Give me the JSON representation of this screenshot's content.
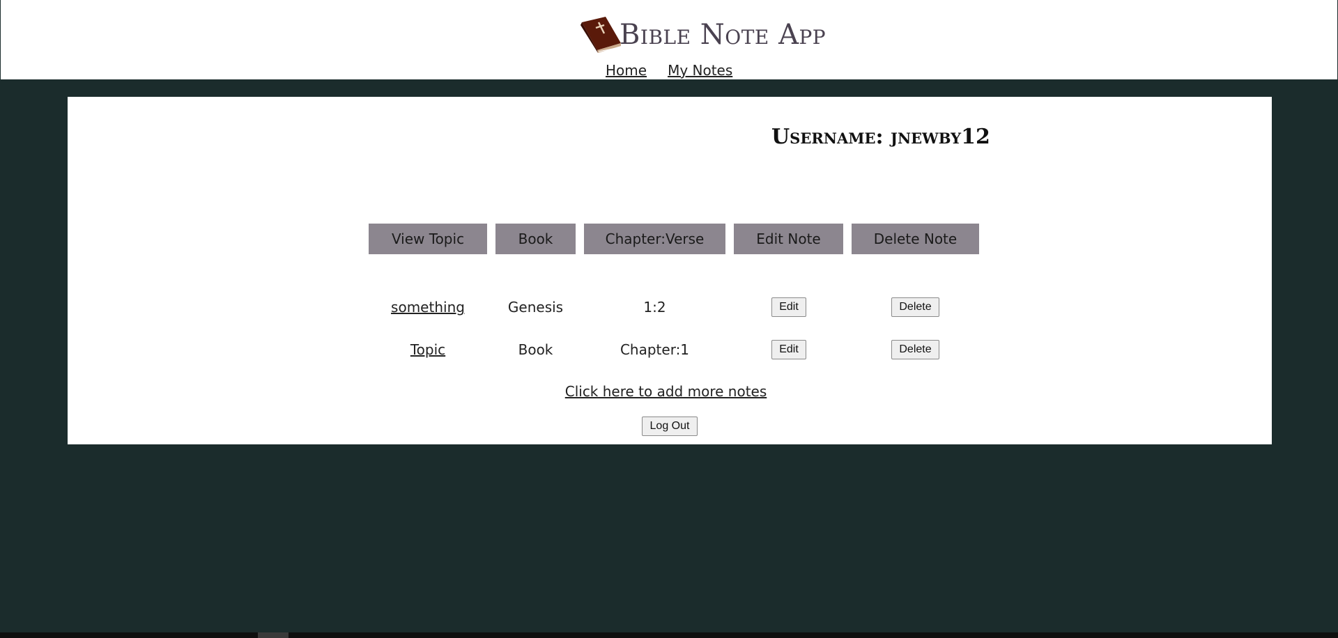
{
  "header": {
    "title": "Bible Note App",
    "logo_icon": "bible-book-icon",
    "nav": [
      {
        "label": "Home"
      },
      {
        "label": "My Notes"
      }
    ]
  },
  "profile": {
    "username_text": "Username: jnewby12"
  },
  "table": {
    "columns": [
      "View Topic",
      "Book",
      "Chapter:Verse",
      "Edit Note",
      "Delete Note"
    ],
    "rows": [
      {
        "topic": "something",
        "book": "Genesis",
        "chapter_verse": "1:2",
        "edit_label": "Edit",
        "delete_label": "Delete"
      },
      {
        "topic": "Topic",
        "book": "Book",
        "chapter_verse": "Chapter:1",
        "edit_label": "Edit",
        "delete_label": "Delete"
      }
    ]
  },
  "actions": {
    "add_notes_link": "Click here to add more notes",
    "logout_label": "Log Out"
  },
  "colors": {
    "page_background": "#1b2c2c",
    "header_button_fill": "#8c868f",
    "title_color": "#4a4250",
    "logo_book": "#5a1a0a"
  }
}
